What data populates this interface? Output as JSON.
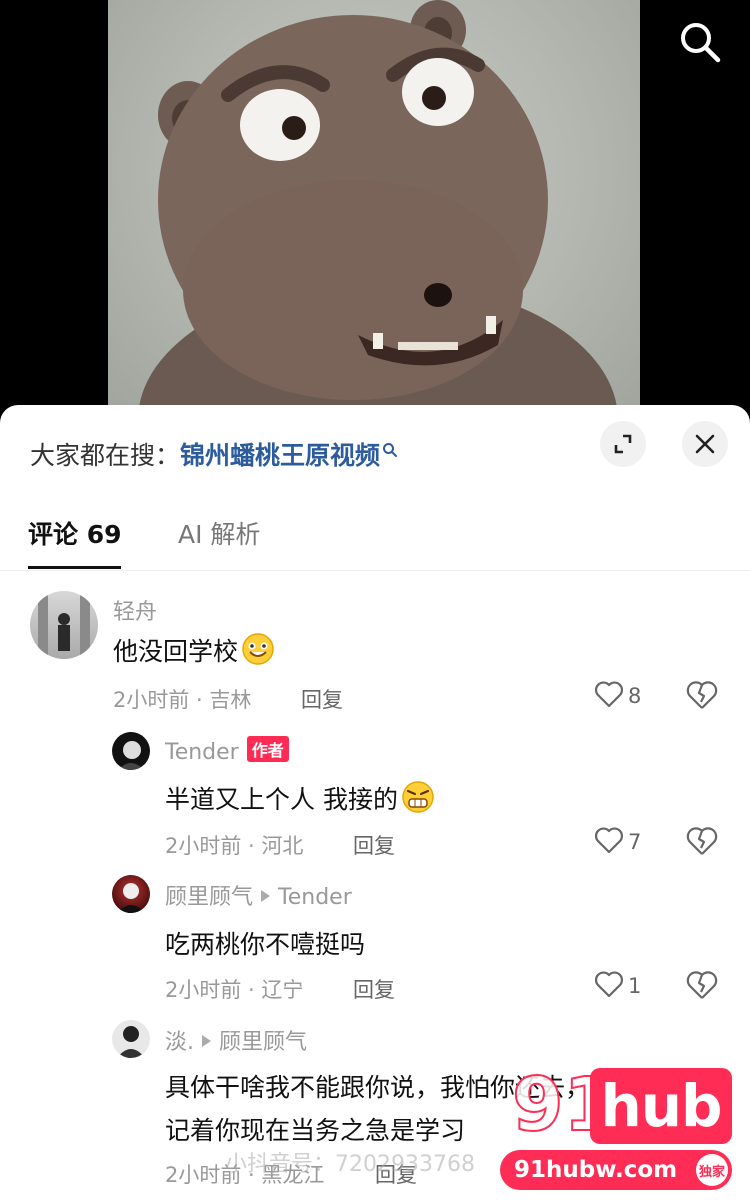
{
  "trending": {
    "prefix": "大家都在搜：",
    "keyword": "锦州蟠桃王原视频"
  },
  "tabs": {
    "comments_label": "评论 69",
    "ai_label": "AI 解析"
  },
  "comments": [
    {
      "name": "轻舟",
      "text": "他没回学校",
      "emoji": "smile-emoji",
      "meta": "2小时前 · 吉林",
      "reply_label": "回复",
      "likes": "8"
    },
    {
      "name": "Tender",
      "author_tag": "作者",
      "text": "半道又上个人 我接的",
      "emoji": "grimace-emoji",
      "meta": "2小时前 · 河北",
      "reply_label": "回复",
      "likes": "7"
    },
    {
      "name": "顾里顾气",
      "reply_to": "Tender",
      "text": "吃两桃你不噎挺吗",
      "meta": "2小时前 · 辽宁",
      "reply_label": "回复",
      "likes": "1"
    },
    {
      "name": "淡.",
      "reply_to": "顾里顾气",
      "text_line1": "具体干啥我不能跟你说，我怕你还去，",
      "text_line2": "记着你现在当务之急是学习",
      "meta": "2小时前 · 黑龙江",
      "reply_label": "回复"
    }
  ],
  "watermark": {
    "brand_prefix": "91",
    "brand_logo": "hub",
    "url": "91hubw.com",
    "exclusive": "独家",
    "account_id": "小抖音号：7202933768"
  },
  "colors": {
    "accent": "#fe2c55",
    "keyword": "#2d5c9e"
  }
}
